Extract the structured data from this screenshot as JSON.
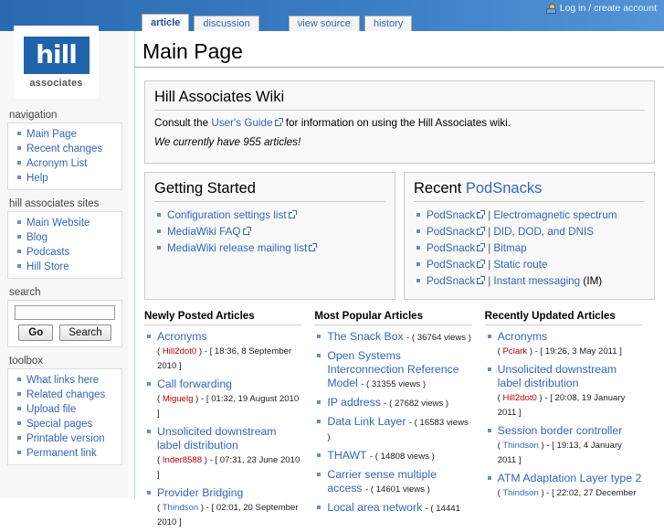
{
  "header": {
    "user_status": "Log in / create account",
    "user_icon": "user-icon",
    "tabs": [
      {
        "label": "article",
        "selected": true
      },
      {
        "label": "discussion",
        "selected": false
      },
      {
        "label": "view source",
        "selected": false
      },
      {
        "label": "history",
        "selected": false
      }
    ]
  },
  "logo": {
    "wordmark": "hill",
    "subtext": "associates"
  },
  "page": {
    "title": "Main Page"
  },
  "sidebar": {
    "sections": [
      {
        "heading": "navigation",
        "items": [
          {
            "label": "Main Page"
          },
          {
            "label": "Recent changes"
          },
          {
            "label": "Acronym List"
          },
          {
            "label": "Help"
          }
        ]
      },
      {
        "heading": "hill associates sites",
        "items": [
          {
            "label": "Main Website"
          },
          {
            "label": "Blog"
          },
          {
            "label": "Podcasts"
          },
          {
            "label": "Hill Store"
          }
        ]
      }
    ],
    "search": {
      "heading": "search",
      "value": "",
      "placeholder": "",
      "go_label": "Go",
      "search_label": "Search"
    },
    "toolbox": {
      "heading": "toolbox",
      "items": [
        {
          "label": "What links here"
        },
        {
          "label": "Related changes"
        },
        {
          "label": "Upload file"
        },
        {
          "label": "Special pages"
        },
        {
          "label": "Printable version"
        },
        {
          "label": "Permanent link"
        }
      ]
    }
  },
  "intro_box": {
    "title": "Hill Associates Wiki",
    "line1_before": "Consult the ",
    "line1_link": "User's Guide",
    "line1_after": " for information on using the Hill Associates wiki.",
    "line2": "We currently have 955 articles!"
  },
  "getting_started": {
    "title": "Getting Started",
    "items": [
      {
        "label": "Configuration settings list",
        "external": true
      },
      {
        "label": "MediaWiki FAQ",
        "external": true
      },
      {
        "label": "MediaWiki release mailing list",
        "external": true
      }
    ]
  },
  "recent_podsnacks": {
    "title_plain": "Recent ",
    "title_link": "PodSnacks",
    "items": [
      {
        "link": "PodSnack",
        "sep": "|",
        "topic": "Electromagnetic spectrum",
        "extra": ""
      },
      {
        "link": "PodSnack",
        "sep": "|",
        "topic": "DID, DOD, and DNIS",
        "extra": ""
      },
      {
        "link": "PodSnack",
        "sep": "|",
        "topic": "Bitmap",
        "extra": ""
      },
      {
        "link": "PodSnack",
        "sep": "|",
        "topic": "Static route",
        "extra": ""
      },
      {
        "link": "PodSnack",
        "sep": "|",
        "topic": "Instant messaging",
        "extra": " (IM)"
      }
    ]
  },
  "newly_posted": {
    "heading": "Newly Posted Articles",
    "items": [
      {
        "title": "Acronyms",
        "user": "Hill2dot0",
        "user_new": true,
        "meta": " ) - [ 18:36, 8 September 2010 ]"
      },
      {
        "title": "Call forwarding",
        "user": "Miguelg",
        "user_new": true,
        "meta": " ) - [ 01:32, 19 August 2010 ]"
      },
      {
        "title": "Unsolicited downstream label distribution",
        "user": "Inder8588",
        "user_new": true,
        "meta": " ) - [ 07:31, 23 June 2010 ]"
      },
      {
        "title": "Provider Bridging",
        "user": "Thindson",
        "user_new": false,
        "meta": " ) - [ 02:01, 20 September 2010 ]"
      }
    ]
  },
  "most_popular": {
    "heading": "Most Popular Articles",
    "items": [
      {
        "title": "The Snack Box",
        "views": "- ( 36764 views )"
      },
      {
        "title": "Open Systems Interconnection Reference Model",
        "views": "- ( 31355 views )"
      },
      {
        "title": "IP address",
        "views": "- ( 27682 views )"
      },
      {
        "title": "Data Link Layer",
        "views": "- ( 16583 views )"
      },
      {
        "title": "THAWT",
        "views": "- ( 14808 views )"
      },
      {
        "title": "Carrier sense multiple access",
        "views": "- ( 14601 views )"
      },
      {
        "title": "Local area network",
        "views": "- ( 14441"
      }
    ]
  },
  "recently_updated": {
    "heading": "Recently Updated Articles",
    "items": [
      {
        "title": "Acronyms",
        "user": "Pclark",
        "user_new": true,
        "meta": " ) - [ 19:26, 3 May 2011 ]"
      },
      {
        "title": "Unsolicited downstream label distribution",
        "user": "Hill2dot0",
        "user_new": true,
        "meta": " ) - [ 20:08, 19 January 2011 ]"
      },
      {
        "title": "Session border controller",
        "user": "Thindson",
        "user_new": false,
        "meta": " ) - [ 19:13, 4 January 2011 ]"
      },
      {
        "title": "ATM Adaptation Layer type 2",
        "user": "Thindson",
        "user_new": false,
        "meta": " ) - [ 22:02, 27 December"
      }
    ]
  },
  "colors": {
    "header_blue_left": "#2a6ab0",
    "header_blue_right": "#5494d7",
    "link_blue": "#3366bb",
    "new_user_red": "#ba0000",
    "box_bg": "#f9f9f9"
  }
}
